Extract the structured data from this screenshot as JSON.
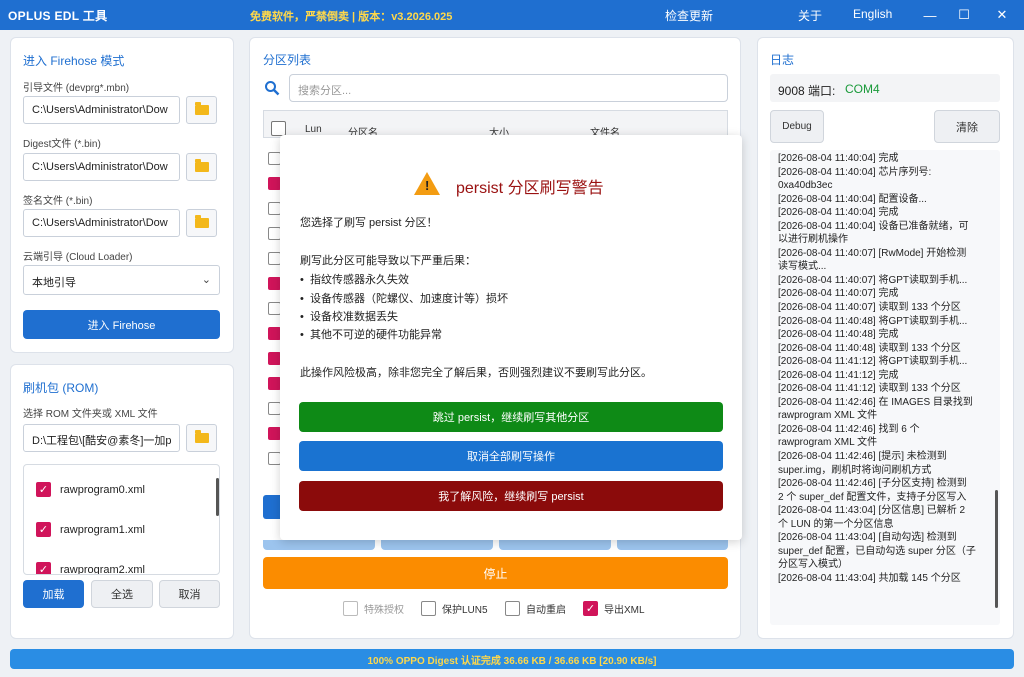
{
  "titlebar": {
    "app_title": "OPLUS EDL 工具",
    "notice": "免费软件，严禁倒卖 | 版本：v3.2026.025",
    "check_update": "检查更新",
    "about": "关于",
    "language": "English"
  },
  "firehose": {
    "title": "进入 Firehose 模式",
    "loader_label": "引导文件 (devprg*.mbn)",
    "loader_path": "C:\\Users\\Administrator\\Dow",
    "digest_label": "Digest文件 (*.bin)",
    "digest_path": "C:\\Users\\Administrator\\Dow",
    "sign_label": "签名文件 (*.bin)",
    "sign_path": "C:\\Users\\Administrator\\Dow",
    "cloud_label": "云端引导 (Cloud Loader)",
    "cloud_value": "本地引导",
    "enter_button": "进入 Firehose"
  },
  "rom": {
    "title": "刷机包 (ROM)",
    "select_label": "选择 ROM 文件夹或 XML 文件",
    "path": "D:\\工程包\\[酷安@素冬]一加p",
    "files": [
      "rawprogram0.xml",
      "rawprogram1.xml",
      "rawprogram2.xml"
    ],
    "load_button": "加载",
    "select_all_button": "全选",
    "cancel_button": "取消"
  },
  "partitions": {
    "title": "分区列表",
    "search_placeholder": "搜索分区...",
    "columns": [
      "Lun",
      "分区名",
      "大小",
      "文件名"
    ],
    "stop_button": "停止",
    "options": [
      {
        "label": "特殊授权",
        "checked": false
      },
      {
        "label": "保护LUN5",
        "checked": false
      },
      {
        "label": "自动重启",
        "checked": false
      },
      {
        "label": "导出XML",
        "checked": true
      }
    ]
  },
  "dialog": {
    "title": "persist 分区刷写警告",
    "intro": "您选择了刷写 persist 分区！",
    "consequence_heading": "刷写此分区可能导致以下严重后果：",
    "consequences": [
      "指纹传感器永久失效",
      "设备传感器（陀螺仪、加速度计等）损坏",
      "设备校准数据丢失",
      "其他不可逆的硬件功能异常"
    ],
    "warning": "此操作风险极高，除非您完全了解后果，否则强烈建议不要刷写此分区。",
    "skip_button": "跳过 persist，继续刷写其他分区",
    "cancel_all_button": "取消全部刷写操作",
    "accept_button": "我了解风险，继续刷写 persist"
  },
  "log_panel": {
    "title": "日志",
    "port_label": "9008 端口:",
    "port_value": "COM4",
    "debug_button": "Debug",
    "clear_button": "清除",
    "lines": [
      "[2026-08-04 11:40:04] 完成",
      "[2026-08-04 11:40:04] 芯片序列号:",
      "0xa40db3ec",
      "[2026-08-04 11:40:04] 配置设备...",
      "[2026-08-04 11:40:04] 完成",
      "[2026-08-04 11:40:04] 设备已准备就绪，可",
      "以进行刷机操作",
      "[2026-08-04 11:40:07] [RwMode] 开始检测",
      "读写模式...",
      "[2026-08-04 11:40:07] 将GPT读取到手机...",
      "[2026-08-04 11:40:07] 完成",
      "[2026-08-04 11:40:07] 读取到 133 个分区",
      "[2026-08-04 11:40:48] 将GPT读取到手机...",
      "[2026-08-04 11:40:48] 完成",
      "[2026-08-04 11:40:48] 读取到 133 个分区",
      "[2026-08-04 11:41:12] 将GPT读取到手机...",
      "[2026-08-04 11:41:12] 完成",
      "[2026-08-04 11:41:12] 读取到 133 个分区",
      "[2026-08-04 11:42:46] 在 IMAGES 目录找到",
      "rawprogram XML 文件",
      "[2026-08-04 11:42:46] 找到 6 个",
      "rawprogram XML 文件",
      "[2026-08-04 11:42:46] [提示] 未检测到",
      "super.img，刷机时将询问刷机方式",
      "[2026-08-04 11:42:46] [子分区支持] 检测到",
      "2 个 super_def 配置文件，支持子分区写入",
      "[2026-08-04 11:43:04] [分区信息] 已解析 2",
      "个 LUN 的第一个分区信息",
      "[2026-08-04 11:43:04] [自动勾选] 检测到",
      "super_def 配置，已自动勾选 super 分区（子",
      "分区写入模式）",
      "[2026-08-04 11:43:04] 共加载 145 个分区"
    ]
  },
  "status": {
    "text": "100% OPPO Digest 认证完成  36.66 KB / 36.66 KB  [20.90 KB/s]",
    "progress": 1.0
  },
  "colors": {
    "accent": "#1f6fd0",
    "checkbox": "#d0145a",
    "stop": "#fb8c00",
    "skip": "#0e8a16",
    "cancel_all": "#1a73d1",
    "accept": "#8b0b0b"
  }
}
